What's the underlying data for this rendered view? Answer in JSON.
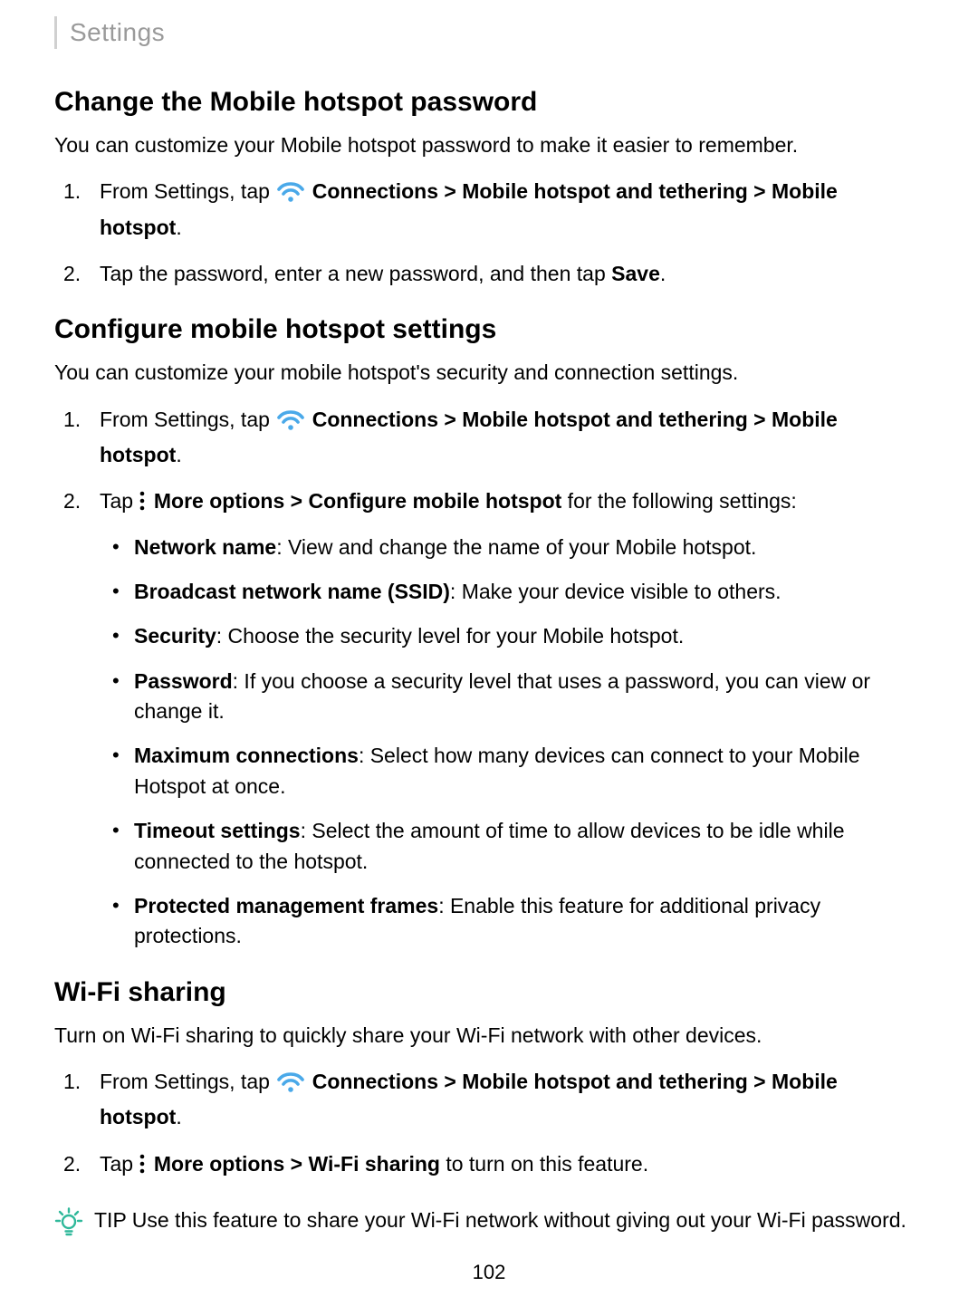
{
  "header": {
    "breadcrumb": "Settings"
  },
  "sections": {
    "s1": {
      "heading": "Change the Mobile hotspot password",
      "lead": "You can customize your Mobile hotspot password to make it easier to remember.",
      "step1_pre": "From Settings, tap ",
      "step1_path1": "Connections",
      "step1_sep": " > ",
      "step1_path2": "Mobile hotspot and tethering",
      "step1_path3": "Mobile hotspot",
      "step1_end": ".",
      "step2_pre": "Tap the password, enter a new password, and then tap ",
      "step2_b": "Save",
      "step2_end": "."
    },
    "s2": {
      "heading": "Configure mobile hotspot settings",
      "lead": "You can customize your mobile hotspot's security and connection settings.",
      "step1_pre": "From Settings, tap ",
      "step1_path1": "Connections",
      "step1_sep": " > ",
      "step1_path2": "Mobile hotspot and tethering",
      "step1_path3": "Mobile hotspot",
      "step1_end": ".",
      "step2_pre": "Tap ",
      "step2_more": "More options",
      "step2_sep": " > ",
      "step2_config": "Configure mobile hotspot",
      "step2_post": " for the following settings:",
      "bullets": {
        "b1_label": "Network name",
        "b1_text": ": View and change the name of your Mobile hotspot.",
        "b2_label": "Broadcast network name (SSID)",
        "b2_text": ": Make your device visible to others.",
        "b3_label": "Security",
        "b3_text": ": Choose the security level for your Mobile hotspot.",
        "b4_label": "Password",
        "b4_text": ": If you choose a security level that uses a password, you can view or change it.",
        "b5_label": "Maximum connections",
        "b5_text": ": Select how many devices can connect to your Mobile Hotspot at once.",
        "b6_label": "Timeout settings",
        "b6_text": ": Select the amount of time to allow devices to be idle while connected to the hotspot.",
        "b7_label": "Protected management frames",
        "b7_text": ": Enable this feature for additional privacy protections."
      }
    },
    "s3": {
      "heading": "Wi-Fi sharing",
      "lead": "Turn on Wi-Fi sharing to quickly share your Wi-Fi network with other devices.",
      "step1_pre": "From Settings, tap ",
      "step1_path1": "Connections",
      "step1_sep": " > ",
      "step1_path2": "Mobile hotspot and tethering",
      "step1_path3": "Mobile hotspot",
      "step1_end": ".",
      "step2_pre": "Tap ",
      "step2_more": "More options",
      "step2_sep": " > ",
      "step2_wifi": "Wi-Fi sharing",
      "step2_post": " to turn on this feature."
    },
    "tip": {
      "label": "TIP",
      "text": "  Use this feature to share your Wi-Fi network without giving out your Wi-Fi password."
    }
  },
  "page_number": "102"
}
